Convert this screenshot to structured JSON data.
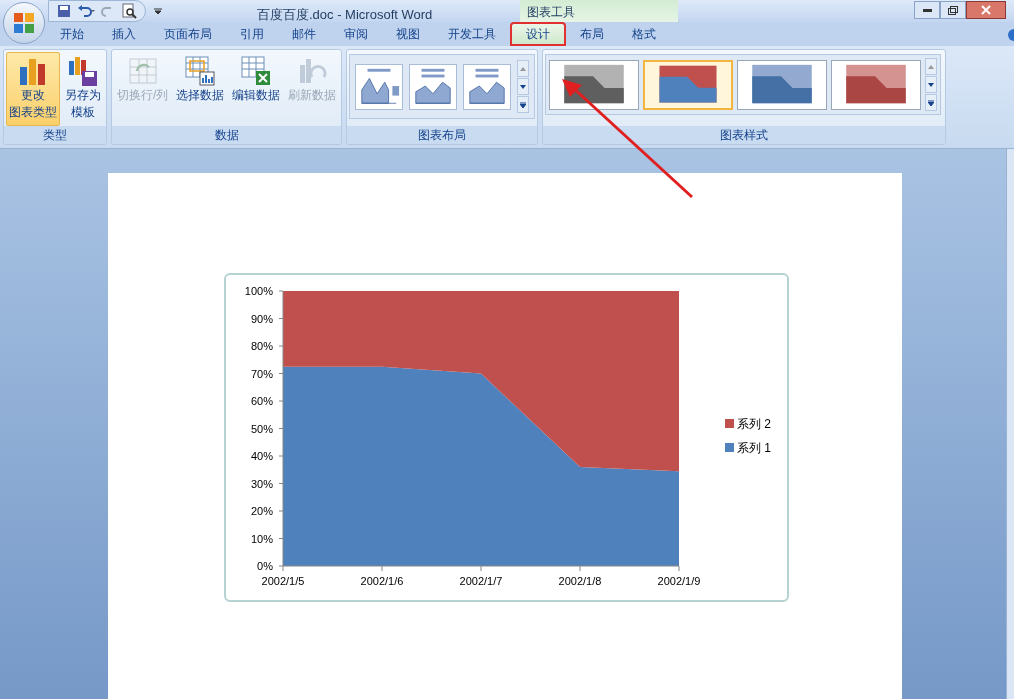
{
  "window": {
    "title": "百度百度.doc - Microsoft Word",
    "context_title": "图表工具"
  },
  "tabs": [
    {
      "label": "开始",
      "selected": false
    },
    {
      "label": "插入",
      "selected": false
    },
    {
      "label": "页面布局",
      "selected": false
    },
    {
      "label": "引用",
      "selected": false
    },
    {
      "label": "邮件",
      "selected": false
    },
    {
      "label": "审阅",
      "selected": false
    },
    {
      "label": "视图",
      "selected": false
    },
    {
      "label": "开发工具",
      "selected": false
    },
    {
      "label": "设计",
      "selected": true
    },
    {
      "label": "布局",
      "selected": false
    },
    {
      "label": "格式",
      "selected": false
    }
  ],
  "ribbon": {
    "groups": [
      {
        "title": "类型",
        "kind": "buttons",
        "buttons": [
          {
            "lines": [
              "更改",
              "图表类型"
            ],
            "selected": true,
            "disabled": false
          },
          {
            "lines": [
              "另存为",
              "模板"
            ],
            "selected": false,
            "disabled": false
          }
        ]
      },
      {
        "title": "数据",
        "kind": "buttons",
        "buttons": [
          {
            "lines": [
              "切换行/列"
            ],
            "selected": false,
            "disabled": true
          },
          {
            "lines": [
              "选择数据"
            ],
            "selected": false,
            "disabled": false
          },
          {
            "lines": [
              "编辑数据"
            ],
            "selected": false,
            "disabled": false
          },
          {
            "lines": [
              "刷新数据"
            ],
            "selected": false,
            "disabled": true
          }
        ]
      },
      {
        "title": "图表布局",
        "kind": "layouts",
        "items": [
          {
            "selected": false
          },
          {
            "selected": false
          },
          {
            "selected": false
          }
        ]
      },
      {
        "title": "图表样式",
        "kind": "styles",
        "items": [
          {
            "selected": false
          },
          {
            "selected": true
          },
          {
            "selected": false
          },
          {
            "selected": false
          }
        ]
      }
    ]
  },
  "chart": {
    "chart_data": {
      "type": "area",
      "stacked": true,
      "legend": "right",
      "categories": [
        "2002/1/5",
        "2002/1/6",
        "2002/1/7",
        "2002/1/8",
        "2002/1/9"
      ],
      "ylim": [
        0,
        100
      ],
      "yticks": [
        {
          "value": 0,
          "label": "0%"
        },
        {
          "value": 10,
          "label": "10%"
        },
        {
          "value": 20,
          "label": "20%"
        },
        {
          "value": 30,
          "label": "30%"
        },
        {
          "value": 40,
          "label": "40%"
        },
        {
          "value": 50,
          "label": "50%"
        },
        {
          "value": 60,
          "label": "60%"
        },
        {
          "value": 70,
          "label": "70%"
        },
        {
          "value": 80,
          "label": "80%"
        },
        {
          "value": 90,
          "label": "90%"
        },
        {
          "value": 100,
          "label": "100%"
        }
      ],
      "series": [
        {
          "name": "系列 1",
          "color": "#4f81bd",
          "values": [
            72.5,
            72.5,
            70,
            36,
            34.5
          ]
        },
        {
          "name": "系列 2",
          "color": "#c0504d",
          "values": [
            27.5,
            27.5,
            30,
            64,
            65.5
          ]
        }
      ]
    }
  }
}
